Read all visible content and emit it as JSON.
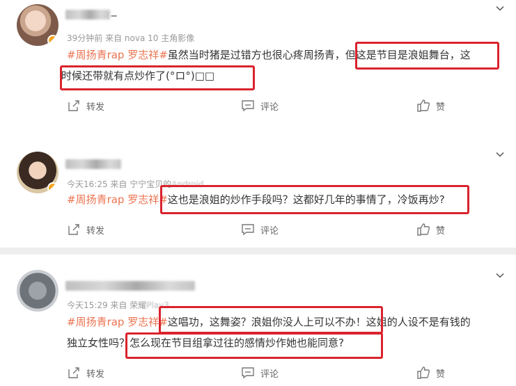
{
  "posts": [
    {
      "meta": "39分钟前  来自 nova 10 主角影像",
      "name_suffix": "_",
      "hashtag": "#周扬青rap 罗志祥#",
      "line1_text": "虽然当时猪是过错方也很心疼周扬青，但这是节目是浪姐舞台，这",
      "line2_text": "时候还带就有点炒作了(°ロ°)□□"
    },
    {
      "meta_visible": "今天16:25  来自 宁宁宝贝的",
      "meta_blur": "Android",
      "hashtag": "#周扬青rap 罗志祥#",
      "line1_text": "这也是浪姐的炒作手段吗？这都好几年的事情了，冷饭再炒?"
    },
    {
      "meta_visible": "今天15:29  来自 荣耀",
      "meta_blur": "Play3",
      "hashtag": "#周扬青rap 罗志祥#",
      "line1_text": "这唱功，这舞姿？浪姐你没人上可以不办！这姐的人设不是有钱的",
      "line2_text": "独立女性吗？怎么现在节目组拿过往的感情炒作她也能同意?"
    }
  ],
  "actions": {
    "repost": "转发",
    "comment": "评论",
    "like": "赞"
  },
  "colors": {
    "hashtag": "#eb7350",
    "highlight": "#d9232e",
    "separator": "#eeeeee"
  },
  "icons": [
    "chevron-down-icon",
    "repost-icon",
    "comment-icon",
    "like-icon",
    "verified-badge-icon"
  ]
}
